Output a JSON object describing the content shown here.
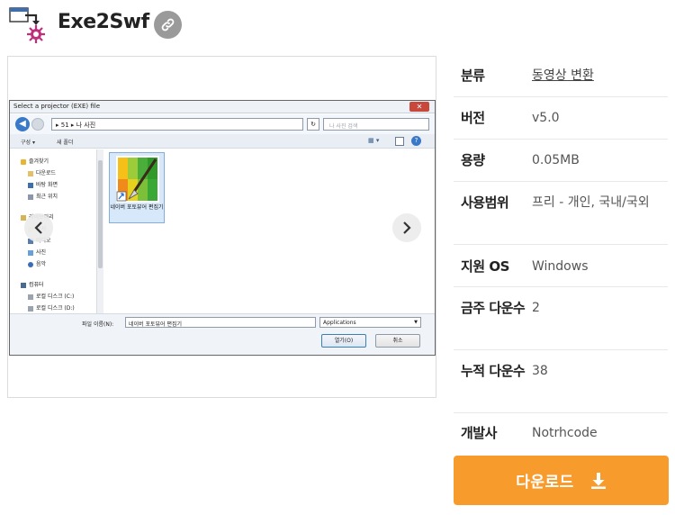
{
  "header": {
    "app_name": "Exe2Swf",
    "app_icon": "exe2swf-program-icon",
    "link_icon": "link-icon"
  },
  "screenshot": {
    "dialog_title": "Select a projector (EXE) file",
    "address_path": "▸ 51 ▸ 나 사진",
    "search_placeholder": "나 사진 검색",
    "organize_label": "구성 ▾",
    "new_folder_label": "새 폴더",
    "nav_items": [
      {
        "label": "즐겨찾기",
        "icon": "star-icon"
      },
      {
        "label": "다운로드",
        "icon": "download-folder-icon"
      },
      {
        "label": "바탕 화면",
        "icon": "desktop-icon"
      },
      {
        "label": "최근 위치",
        "icon": "recent-icon"
      },
      {
        "label": "라이브러리",
        "icon": "library-icon"
      },
      {
        "label": "문서",
        "icon": "documents-icon"
      },
      {
        "label": "비디오",
        "icon": "video-icon"
      },
      {
        "label": "사진",
        "icon": "pictures-icon"
      },
      {
        "label": "음악",
        "icon": "music-icon"
      },
      {
        "label": "컴퓨터",
        "icon": "computer-icon"
      },
      {
        "label": "로컬 디스크 (C:)",
        "icon": "drive-icon"
      },
      {
        "label": "로컬 디스크 (D:)",
        "icon": "drive-icon"
      }
    ],
    "file_name_label": "파일 이름(N):",
    "file_name_value": "네이버 포토뷰어 편집기",
    "file_tile_label": "네이버 포토뷰어 편집기",
    "file_type_value": "Applications",
    "open_label": "열기(O)",
    "cancel_label": "취소"
  },
  "info": {
    "rows": [
      {
        "key": "분류",
        "value": "동영상 변환"
      },
      {
        "key": "버전",
        "value": "v5.0"
      },
      {
        "key": "용량",
        "value": "0.05MB"
      },
      {
        "key": "사용범위",
        "value": "프리 - 개인, 국내/국외"
      },
      {
        "key": "지원 OS",
        "value": "Windows"
      },
      {
        "key": "금주 다운수",
        "value": "2"
      },
      {
        "key": "누적 다운수",
        "value": "38"
      },
      {
        "key": "개발사",
        "value": "Notrhcode"
      }
    ]
  },
  "download": {
    "label": "다운로드",
    "icon": "download-icon",
    "color": "#f89b2d"
  }
}
